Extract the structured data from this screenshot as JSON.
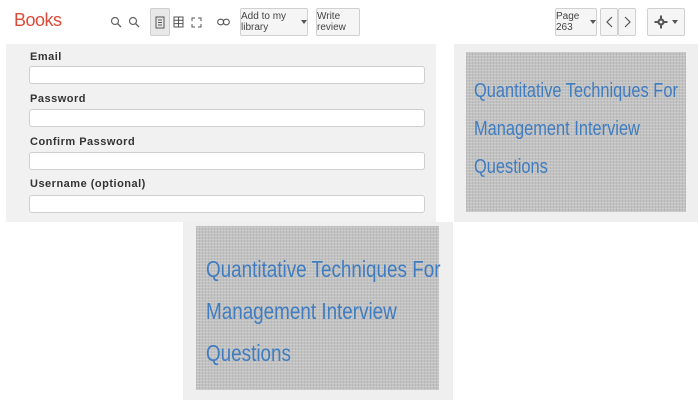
{
  "toolbar": {
    "brand": "Books",
    "add_library_label": "Add to my library",
    "write_review_label": "Write review",
    "page_label": "Page 263",
    "icons": {
      "zoom_in": "zoom-in-icon",
      "zoom_out": "zoom-out-icon",
      "single_page": "single-page-view-icon",
      "grid": "grid-view-icon",
      "fullscreen": "fullscreen-icon",
      "link": "link-icon",
      "prev": "chevron-left-icon",
      "next": "chevron-right-icon",
      "settings": "gear-icon"
    }
  },
  "form": {
    "email_label": "Email",
    "password_label": "Password",
    "confirm_password_label": "Confirm Password",
    "username_label": "Username (optional)",
    "email_value": "",
    "password_value": "",
    "confirm_password_value": "",
    "username_value": ""
  },
  "pages": [
    {
      "title_lines": [
        "Quantitative Techniques For",
        "Management Interview",
        "Questions"
      ]
    },
    {
      "title_lines": [
        "Quantitative Techniques For",
        "Management Interview",
        "Questions"
      ]
    }
  ],
  "colors": {
    "brand": "#dd4b39",
    "title": "#3f7dc0",
    "page_bg": "#c2c2c2"
  }
}
